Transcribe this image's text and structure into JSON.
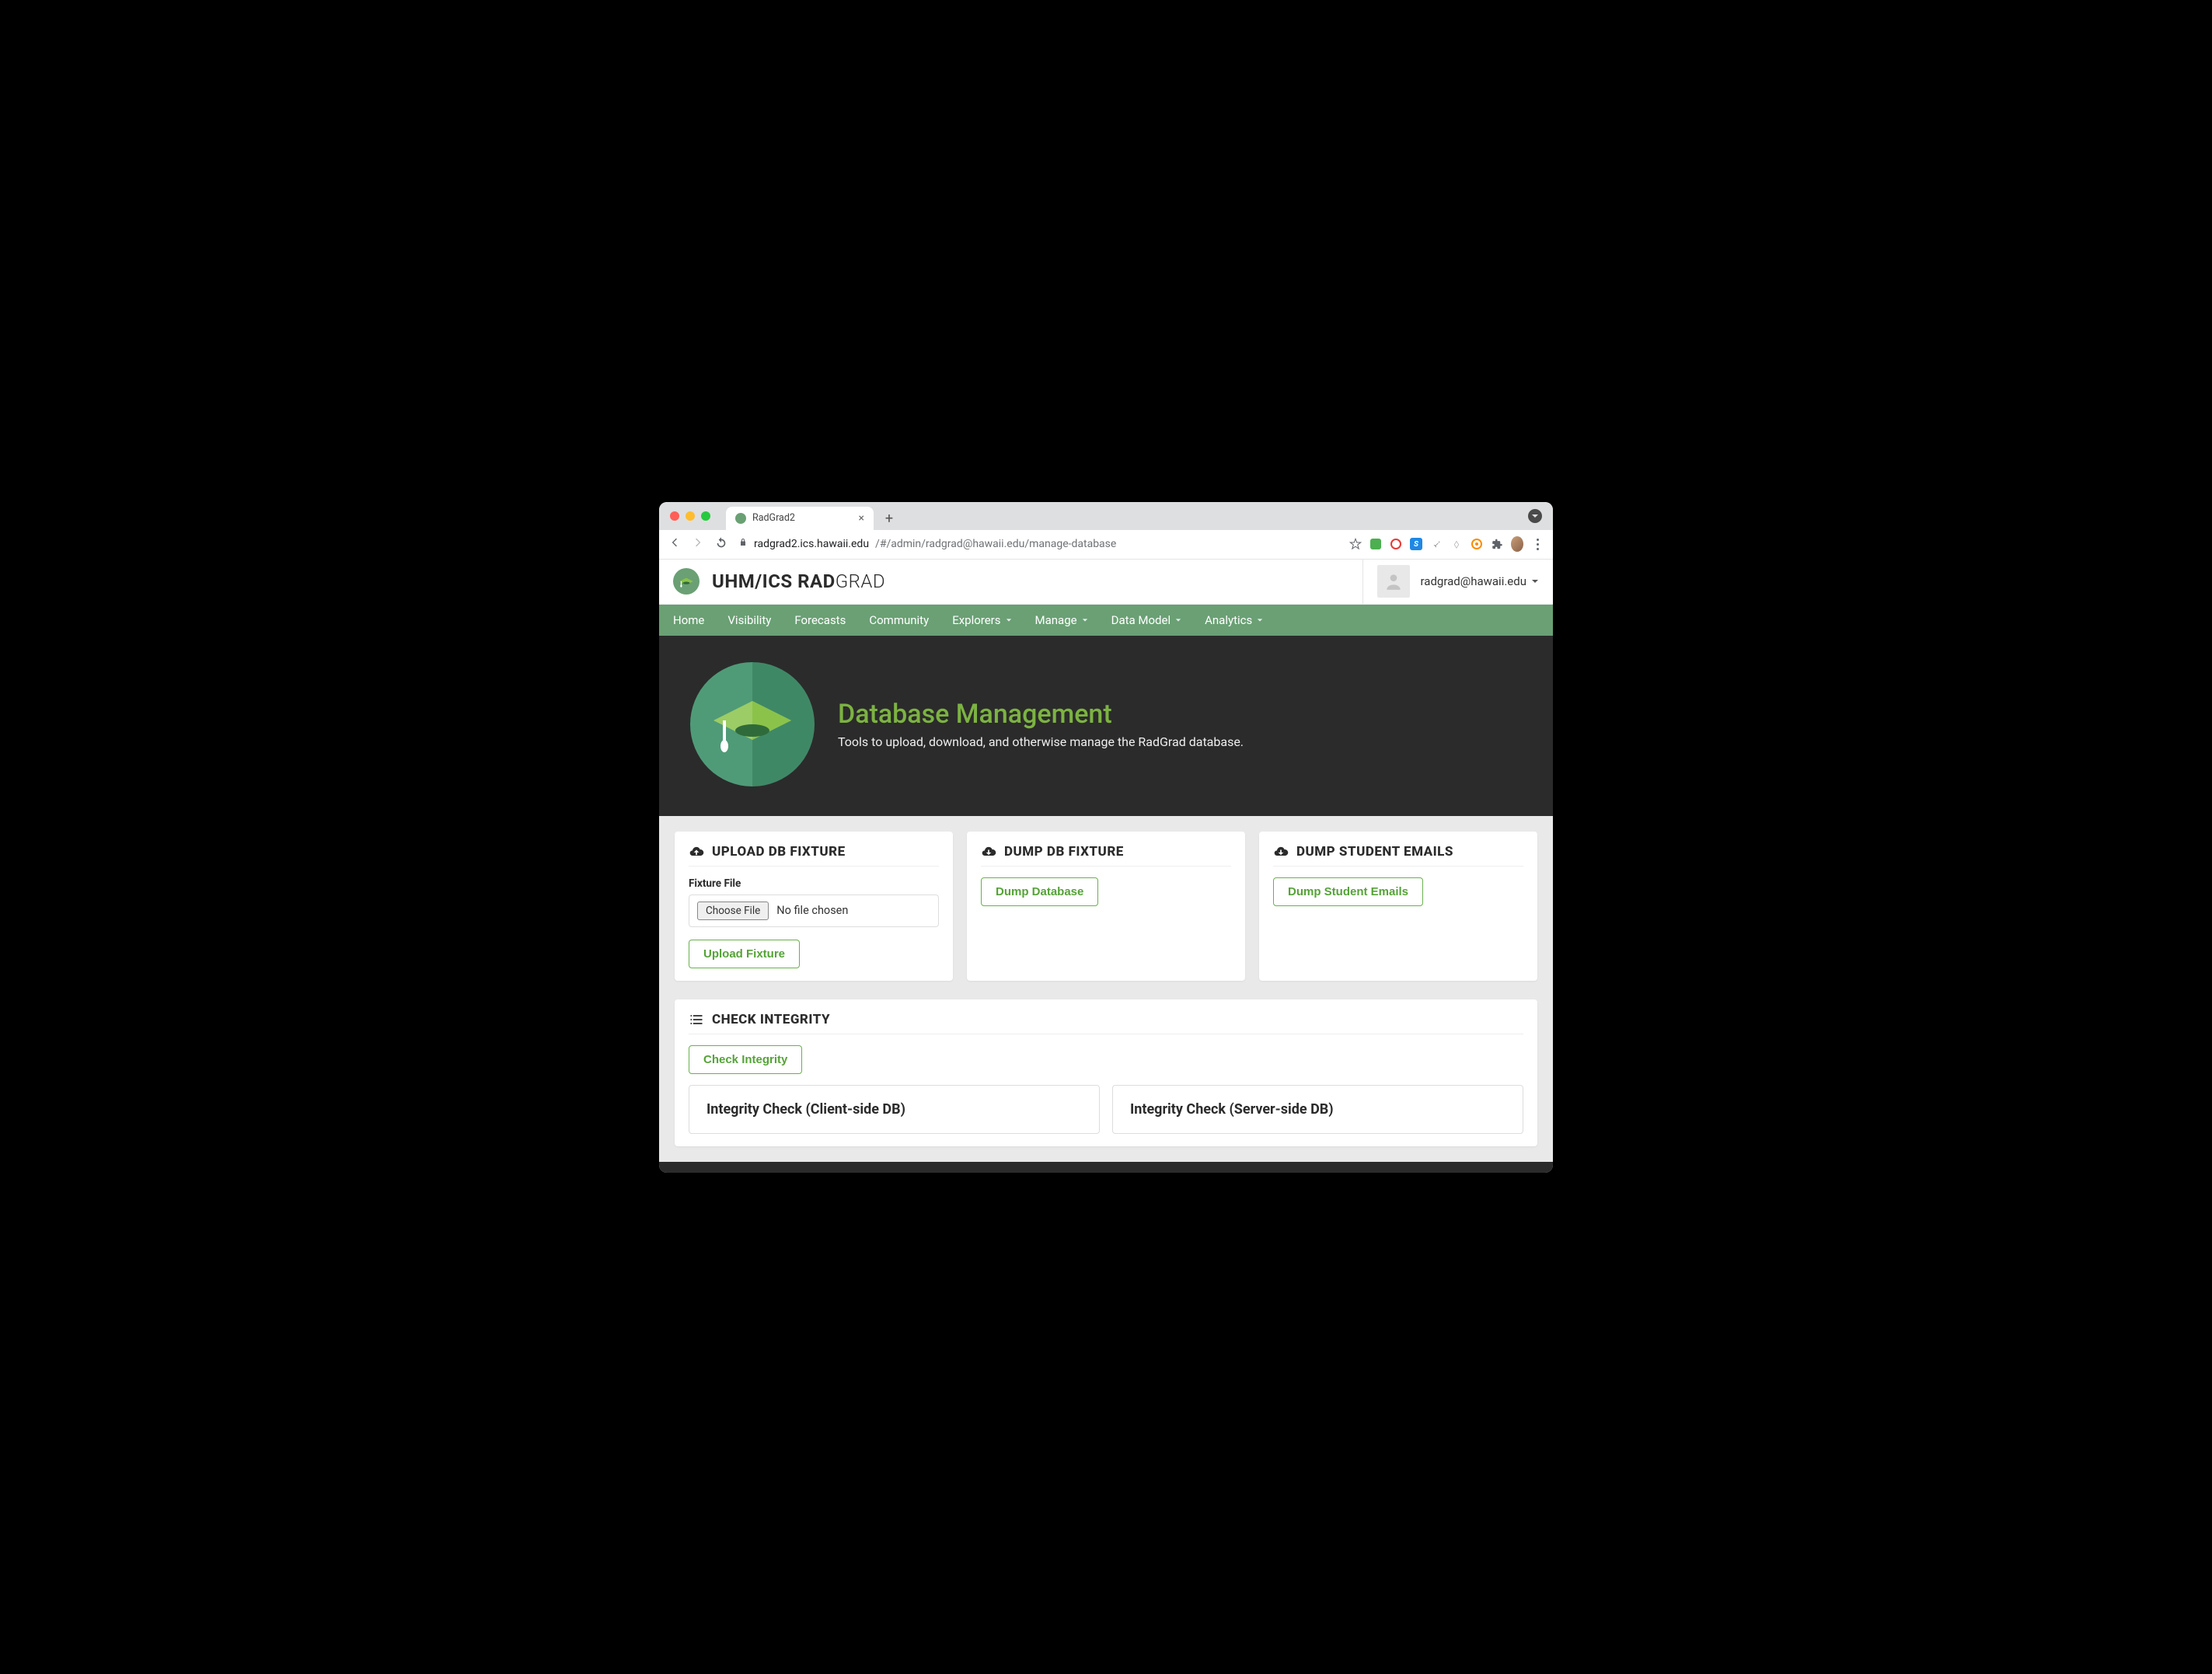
{
  "browser": {
    "tab_title": "RadGrad2",
    "url_domain": "radgrad2.ics.hawaii.edu",
    "url_path": "/#/admin/radgrad@hawaii.edu/manage-database"
  },
  "header": {
    "title_bold": "UHM/ICS RAD",
    "title_thin": "GRAD",
    "user_email": "radgrad@hawaii.edu"
  },
  "nav": {
    "items": [
      {
        "label": "Home",
        "dropdown": false
      },
      {
        "label": "Visibility",
        "dropdown": false
      },
      {
        "label": "Forecasts",
        "dropdown": false
      },
      {
        "label": "Community",
        "dropdown": false
      },
      {
        "label": "Explorers",
        "dropdown": true
      },
      {
        "label": "Manage",
        "dropdown": true
      },
      {
        "label": "Data Model",
        "dropdown": true
      },
      {
        "label": "Analytics",
        "dropdown": true
      }
    ]
  },
  "hero": {
    "title": "Database Management",
    "subtitle": "Tools to upload, download, and otherwise manage the RadGrad database."
  },
  "cards": {
    "upload": {
      "title": "UPLOAD DB FIXTURE",
      "field_label": "Fixture File",
      "choose_label": "Choose File",
      "no_file_text": "No file chosen",
      "button": "Upload Fixture"
    },
    "dump_db": {
      "title": "DUMP DB FIXTURE",
      "button": "Dump Database"
    },
    "dump_emails": {
      "title": "DUMP STUDENT EMAILS",
      "button": "Dump Student Emails"
    },
    "integrity": {
      "title": "CHECK INTEGRITY",
      "button": "Check Integrity",
      "client_box": "Integrity Check (Client-side DB)",
      "server_box": "Integrity Check (Server-side DB)"
    }
  }
}
